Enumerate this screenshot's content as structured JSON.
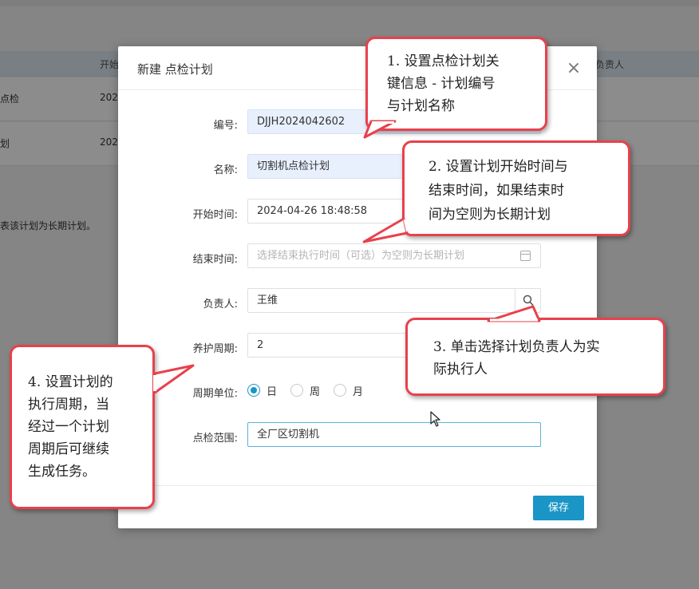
{
  "background": {
    "header_start_col": "开始",
    "header_owner_col": "负责人",
    "rows": [
      {
        "name": "点检",
        "start": "202"
      },
      {
        "name": "划",
        "start": "202"
      }
    ],
    "note_fragment": "表该计划为长期计划。"
  },
  "modal": {
    "title": "新建 点检计划",
    "close_symbol": "×",
    "fields": {
      "code": {
        "label": "编号:",
        "value": "DJJH2024042602"
      },
      "name": {
        "label": "名称:",
        "value": "切割机点检计划"
      },
      "start_time": {
        "label": "开始时间:",
        "value": "2024-04-26 18:48:58"
      },
      "end_time": {
        "label": "结束时间:",
        "placeholder": "选择结束执行时间（可选）为空则为长期计划"
      },
      "owner": {
        "label": "负责人:",
        "value": "王维"
      },
      "maintenance_period": {
        "label": "养护周期:",
        "value": "2"
      },
      "period_unit": {
        "label": "周期单位:",
        "options": [
          "日",
          "周",
          "月"
        ],
        "selected": "日"
      },
      "inspection_scope": {
        "label": "点检范围:",
        "value": "全厂区切割机"
      }
    },
    "save_label": "保存"
  },
  "callouts": {
    "c1": [
      "1. 设置点检计划关",
      "键信息 - 计划编号",
      "与计划名称"
    ],
    "c2": [
      "2. 设置计划开始时间与",
      "结束时间，如果结束时",
      "间为空则为长期计划"
    ],
    "c3": [
      "3. 单击选择计划负责人为实",
      "际执行人"
    ],
    "c4": [
      "4. 设置计划的",
      "执行周期，当",
      "经过一个计划",
      "周期后可继续",
      "生成任务。"
    ]
  },
  "colors": {
    "accent": "#1a95c6",
    "callout_border": "#e8414c",
    "readonly_fill": "#e8f0fe"
  }
}
